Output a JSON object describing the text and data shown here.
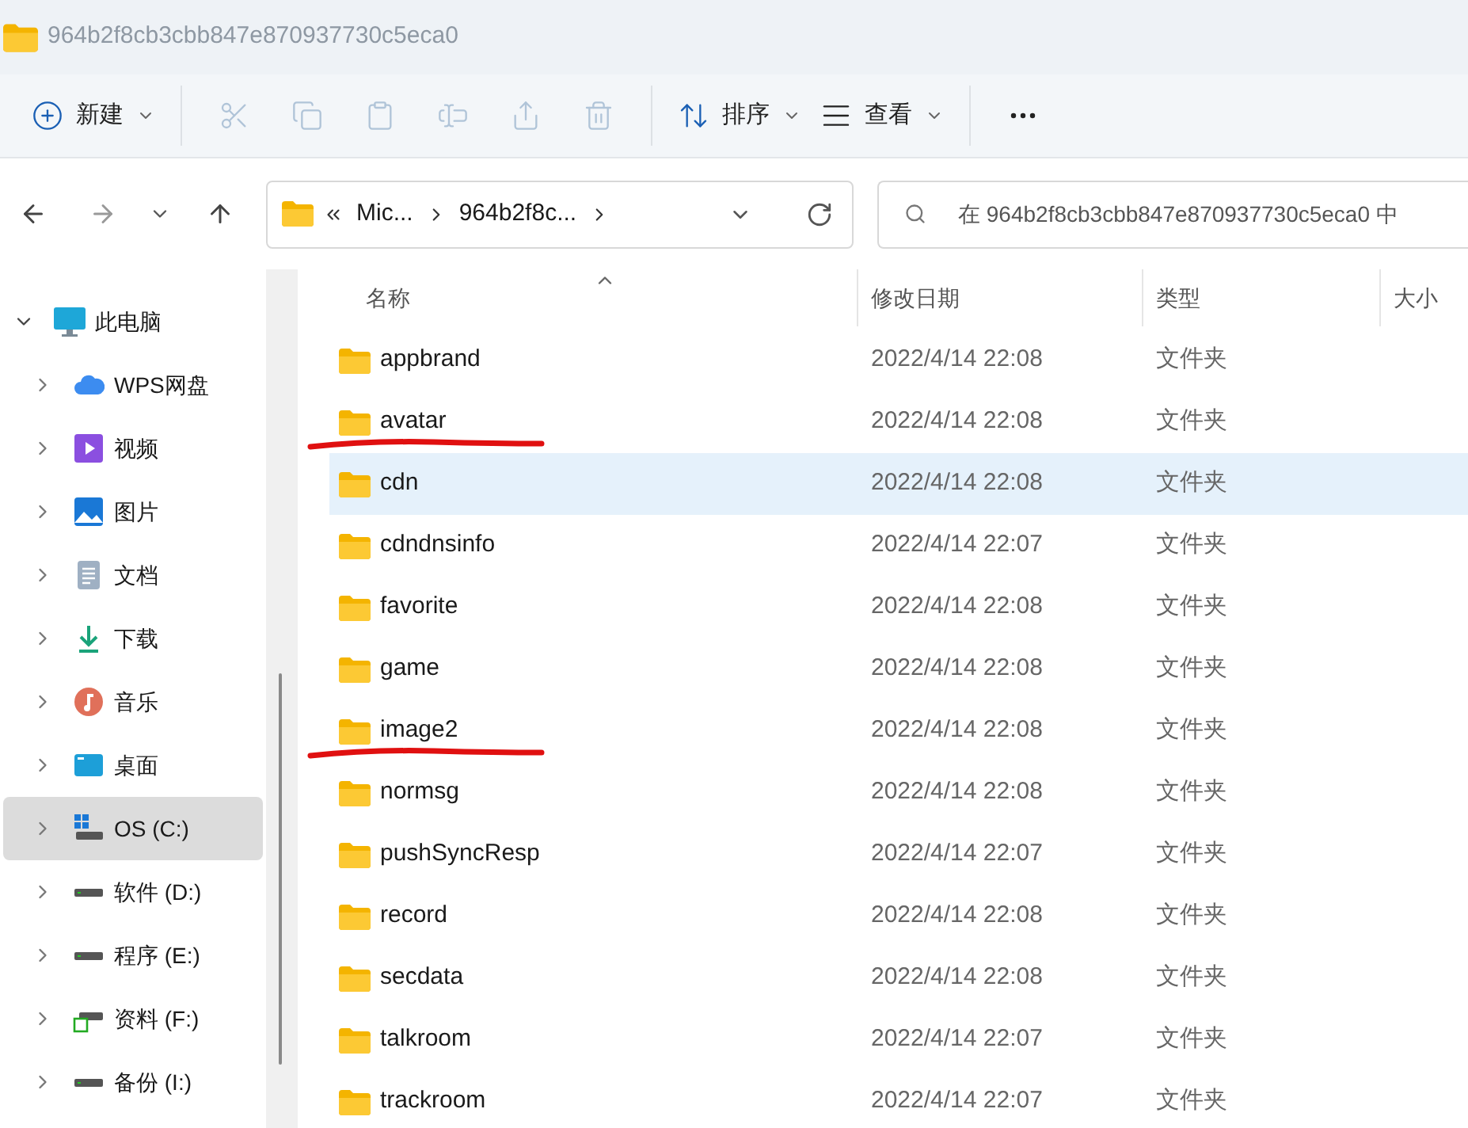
{
  "window": {
    "title": "964b2f8cb3cbb847e870937730c5eca0"
  },
  "toolbar": [
    {
      "kind": "new",
      "label": "新建",
      "disabled": false
    },
    {
      "kind": "cut",
      "disabled": true
    },
    {
      "kind": "copy",
      "disabled": true
    },
    {
      "kind": "paste",
      "disabled": true
    },
    {
      "kind": "rename",
      "disabled": true
    },
    {
      "kind": "share",
      "disabled": true
    },
    {
      "kind": "delete",
      "disabled": true
    },
    {
      "kind": "sort",
      "label": "排序",
      "disabled": false
    },
    {
      "kind": "view",
      "label": "查看",
      "disabled": false
    },
    {
      "kind": "more",
      "disabled": false
    }
  ],
  "address": {
    "crumbs": [
      "Mic...",
      "964b2f8c..."
    ]
  },
  "search": {
    "placeholder": "在 964b2f8cb3cbb847e870937730c5eca0 中"
  },
  "sidebar": {
    "items": [
      {
        "label": "此电脑",
        "kind": "pc",
        "expanded": true,
        "selected": false,
        "children": [
          {
            "label": "WPS网盘",
            "kind": "cloud",
            "expanded": false,
            "selected": false
          },
          {
            "label": "视频",
            "kind": "video",
            "expanded": false,
            "selected": false
          },
          {
            "label": "图片",
            "kind": "picture",
            "expanded": false,
            "selected": false
          },
          {
            "label": "文档",
            "kind": "document",
            "expanded": false,
            "selected": false
          },
          {
            "label": "下载",
            "kind": "download",
            "expanded": false,
            "selected": false
          },
          {
            "label": "音乐",
            "kind": "music",
            "expanded": false,
            "selected": false
          },
          {
            "label": "桌面",
            "kind": "desktop",
            "expanded": false,
            "selected": false
          },
          {
            "label": "OS (C:)",
            "kind": "system-drive",
            "expanded": false,
            "selected": true
          },
          {
            "label": "软件 (D:)",
            "kind": "drive",
            "expanded": false,
            "selected": false
          },
          {
            "label": "程序 (E:)",
            "kind": "drive",
            "expanded": false,
            "selected": false
          },
          {
            "label": "资料 (F:)",
            "kind": "shared-drive",
            "expanded": false,
            "selected": false
          },
          {
            "label": "备份 (I:)",
            "kind": "drive",
            "expanded": false,
            "selected": false
          }
        ]
      }
    ]
  },
  "table": {
    "columns": [
      {
        "label": "名称",
        "sorted": true
      },
      {
        "label": "修改日期",
        "sorted": false
      },
      {
        "label": "类型",
        "sorted": false
      },
      {
        "label": "大小",
        "sorted": false
      }
    ],
    "rows": [
      {
        "name": "appbrand",
        "date": "2022/4/14 22:08",
        "type": "文件夹",
        "highlighted": false,
        "marked": false
      },
      {
        "name": "avatar",
        "date": "2022/4/14 22:08",
        "type": "文件夹",
        "highlighted": false,
        "marked": true
      },
      {
        "name": "cdn",
        "date": "2022/4/14 22:08",
        "type": "文件夹",
        "highlighted": true,
        "marked": false
      },
      {
        "name": "cdndnsinfo",
        "date": "2022/4/14 22:07",
        "type": "文件夹",
        "highlighted": false,
        "marked": false
      },
      {
        "name": "favorite",
        "date": "2022/4/14 22:08",
        "type": "文件夹",
        "highlighted": false,
        "marked": false
      },
      {
        "name": "game",
        "date": "2022/4/14 22:08",
        "type": "文件夹",
        "highlighted": false,
        "marked": false
      },
      {
        "name": "image2",
        "date": "2022/4/14 22:08",
        "type": "文件夹",
        "highlighted": false,
        "marked": true
      },
      {
        "name": "normsg",
        "date": "2022/4/14 22:08",
        "type": "文件夹",
        "highlighted": false,
        "marked": false
      },
      {
        "name": "pushSyncResp",
        "date": "2022/4/14 22:07",
        "type": "文件夹",
        "highlighted": false,
        "marked": false
      },
      {
        "name": "record",
        "date": "2022/4/14 22:08",
        "type": "文件夹",
        "highlighted": false,
        "marked": false
      },
      {
        "name": "secdata",
        "date": "2022/4/14 22:08",
        "type": "文件夹",
        "highlighted": false,
        "marked": false
      },
      {
        "name": "talkroom",
        "date": "2022/4/14 22:07",
        "type": "文件夹",
        "highlighted": false,
        "marked": false
      },
      {
        "name": "trackroom",
        "date": "2022/4/14 22:07",
        "type": "文件夹",
        "highlighted": false,
        "marked": false
      }
    ]
  }
}
